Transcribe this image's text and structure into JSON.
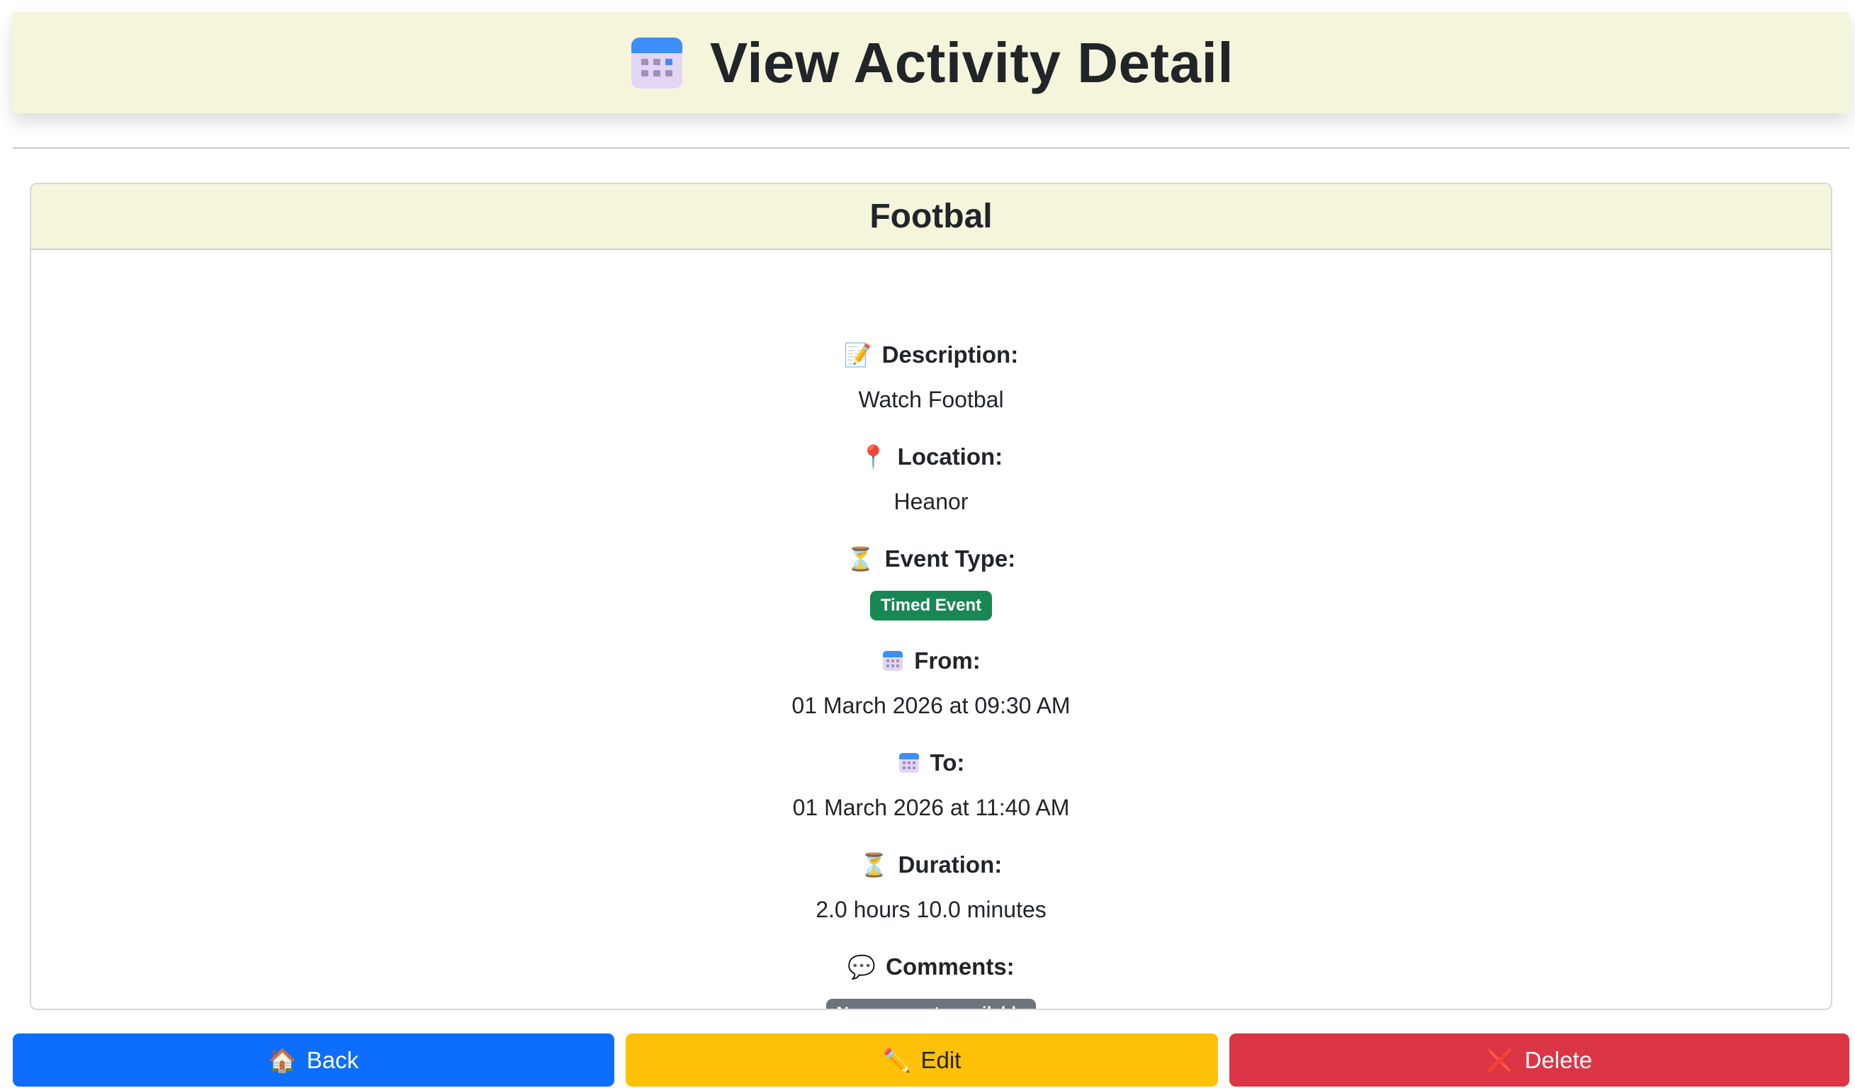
{
  "header": {
    "title": "View Activity Detail",
    "icon": "calendar-icon"
  },
  "activity": {
    "name": "Footbal",
    "fields": {
      "description_label": "Description:",
      "description_value": "Watch Footbal",
      "location_label": "Location:",
      "location_value": "Heanor",
      "event_type_label": "Event Type:",
      "event_type_value": "Timed Event",
      "from_label": "From:",
      "from_value": "01 March 2026 at 09:30 AM",
      "to_label": "To:",
      "to_value": "01 March 2026 at 11:40 AM",
      "duration_label": "Duration:",
      "duration_value": "2.0 hours 10.0 minutes",
      "comments_label": "Comments:",
      "comments_value": "No comments available"
    }
  },
  "actions": {
    "back_label": "Back",
    "back_icon": "🏠",
    "edit_label": "Edit",
    "edit_icon": "✏️",
    "delete_label": "Delete",
    "delete_icon": "❌"
  },
  "icons": {
    "description": "📝",
    "location": "📍",
    "event_type": "⏳",
    "duration": "⏳",
    "comments": "💬"
  },
  "colors": {
    "header_bg": "#f5f5dc",
    "primary": "#0d6efd",
    "warning": "#ffc107",
    "danger": "#dc3545",
    "success": "#198754",
    "secondary": "#6c757d"
  }
}
